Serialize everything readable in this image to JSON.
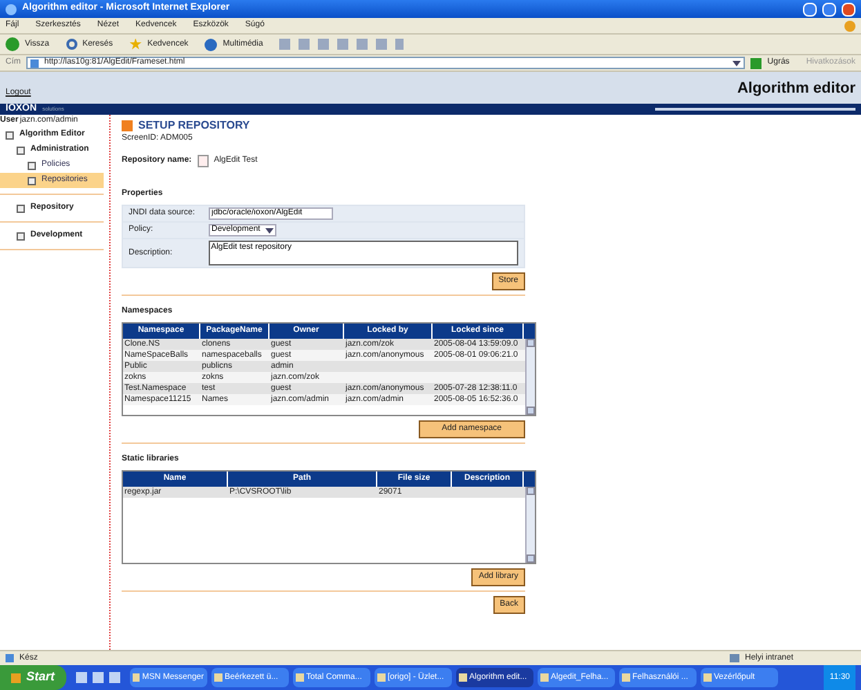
{
  "window": {
    "title": "Algorithm editor - Microsoft Internet Explorer"
  },
  "menu": [
    "Fájl",
    "Szerkesztés",
    "Nézet",
    "Kedvencek",
    "Eszközök",
    "Súgó"
  ],
  "toolbar": [
    {
      "label": "Vissza",
      "kind": "back"
    },
    {
      "label": "Keresés",
      "kind": "search"
    },
    {
      "label": "Kedvencek",
      "kind": "star"
    },
    {
      "label": "Multimédia",
      "kind": "media"
    }
  ],
  "address": {
    "label": "Cím",
    "value": "http://las10g:81/AlgEdit/Frameset.html",
    "go": "Ugrás",
    "links": "Hivatkozások"
  },
  "app": {
    "logout": "Logout",
    "title": "Algorithm editor",
    "logo": "IOXON",
    "logo_sub": "solutions"
  },
  "user": {
    "label": "User",
    "value": "jazn.com/admin"
  },
  "tree": [
    {
      "label": "Algorithm Editor",
      "selected": false,
      "children": [
        {
          "label": "Administration",
          "selected": false,
          "children": [
            {
              "label": "Policies",
              "selected": false
            },
            {
              "label": "Repositories",
              "selected": true
            }
          ]
        },
        {
          "label": "Repository",
          "selected": false
        },
        {
          "label": "Development",
          "selected": false
        }
      ]
    }
  ],
  "page": {
    "title": "SETUP REPOSITORY",
    "screen_id": "ScreenID: ADM005",
    "name_label": "Repository name:",
    "name_value": "AlgEdit Test"
  },
  "properties": {
    "title": "Properties",
    "fields": [
      {
        "kind": "text",
        "label": "JNDI data source:",
        "value": "jdbc/oracle/ioxon/AlgEdit"
      },
      {
        "kind": "select",
        "label": "Policy:",
        "value": "Development"
      },
      {
        "kind": "textarea",
        "label": "Description:",
        "value": "AlgEdit test repository"
      }
    ],
    "button": "Store"
  },
  "namespaces": {
    "title": "Namespaces",
    "columns": [
      "Namespace",
      "PackageName",
      "Owner",
      "Locked by",
      "Locked since"
    ],
    "rows": [
      [
        "Clone.NS",
        "clonens",
        "guest",
        "jazn.com/zok",
        "2005-08-04 13:59:09.0"
      ],
      [
        "NameSpaceBalls",
        "namespaceballs",
        "guest",
        "jazn.com/anonymous",
        "2005-08-01 09:06:21.0"
      ],
      [
        "Public",
        "publicns",
        "admin"
      ],
      [
        "zokns",
        "zokns",
        "jazn.com/zok"
      ],
      [
        "Test.Namespace",
        "test",
        "guest",
        "jazn.com/anonymous",
        "2005-07-28 12:38:11.0"
      ],
      [
        "Namespace11215",
        "Names",
        "jazn.com/admin",
        "jazn.com/admin",
        "2005-08-05 16:52:36.0"
      ]
    ],
    "button": "Add namespace"
  },
  "libraries": {
    "title": "Static libraries",
    "columns": [
      "Name",
      "Path",
      "File size",
      "Description"
    ],
    "rows": [
      [
        "regexp.jar",
        "P:\\CVSROOT\\lib",
        "29071"
      ]
    ],
    "button": "Add library"
  },
  "back": "Back",
  "status_bar": {
    "text": "Kész",
    "zone": "Helyi intranet"
  },
  "taskbar": {
    "start": "Start",
    "items": [
      {
        "label": "MSN Messenger",
        "selected": false
      },
      {
        "label": "Beérkezett ü...",
        "selected": false
      },
      {
        "label": "Total Comma...",
        "selected": false
      },
      {
        "label": "[origo] - Üzlet...",
        "selected": false
      },
      {
        "label": "Algorithm edit...",
        "selected": true
      },
      {
        "label": "Algedit_Felha...",
        "selected": false
      },
      {
        "label": "Felhasználói ...",
        "selected": false
      },
      {
        "label": "Vezérlőpult",
        "selected": false
      }
    ],
    "clock": "11:30"
  }
}
